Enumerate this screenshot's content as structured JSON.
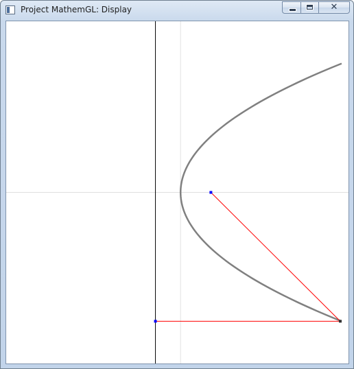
{
  "window": {
    "title": "Project MathemGL: Display",
    "icon": "app-window-icon",
    "buttons": {
      "minimize": "minimize-icon",
      "maximize": "maximize-icon",
      "close": "close-icon",
      "close_glyph": "✕"
    }
  },
  "colors": {
    "curve": "#808080",
    "line": "#ff0000",
    "axis": "#000000",
    "grid": "#e0e0e0",
    "focus_point": "#0000ff",
    "directrix_point": "#0000ff",
    "curve_point": "#333333"
  },
  "chart_data": {
    "type": "line",
    "description_visible": "parabola opening right with focus, directrix foot and point on curve",
    "xlim": [
      -0.8,
      1.0
    ],
    "ylim": [
      -1.0,
      1.0
    ],
    "axis_x": 0,
    "grid_lines": {
      "x": [
        0.136
      ],
      "y": [
        0.0
      ]
    },
    "parabola": {
      "vertex": [
        0.136,
        0.0
      ],
      "focus": [
        0.3,
        0.0
      ],
      "p": 0.164,
      "y_range": [
        -0.756,
        0.756
      ]
    },
    "points": [
      {
        "label": "focus",
        "x": 0.3,
        "y": 0.0
      },
      {
        "label": "curve_point",
        "x": 1.0,
        "y": -0.756
      },
      {
        "label": "directrix_foot",
        "x": 0.0,
        "y": -0.756
      }
    ],
    "segments": [
      {
        "from": "focus",
        "to": "curve_point"
      },
      {
        "from": "directrix_foot",
        "to": "curve_point"
      }
    ]
  }
}
